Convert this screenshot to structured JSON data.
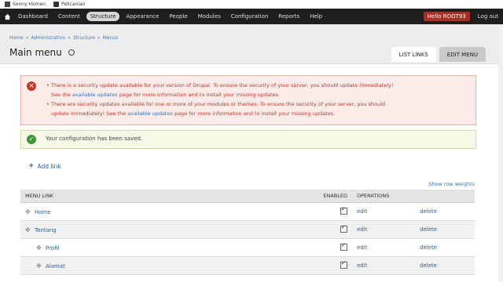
{
  "shortcuts": [
    {
      "label": "Sonny Homen"
    },
    {
      "label": "Pelicanian"
    }
  ],
  "toolbar": {
    "items": [
      "Dashboard",
      "Content",
      "Structure",
      "Appearance",
      "People",
      "Modules",
      "Configuration",
      "Reports",
      "Help"
    ],
    "active": "Structure",
    "hello": "Hello ROOT93",
    "logout": "Log out"
  },
  "breadcrumb": [
    "Home",
    "Administration",
    "Structure",
    "Menus"
  ],
  "page_title": "Main menu",
  "tabs": [
    "LIST LINKS",
    "EDIT MENU"
  ],
  "error": {
    "item1_a": "There is a security update available for your version of Drupal. To ensure the security of your server, you should update immediately!",
    "item1_b": "See the",
    "item1_link": "available updates",
    "item1_c": "page for more information and to install your missing updates.",
    "item2_a": "There are security updates available for one or more of your modules or themes. To ensure the security of your server, you should",
    "item2_b": "update immediately! See the",
    "item2_link": "available updates",
    "item2_c": "page for more information and to install your missing updates."
  },
  "status": "Your configuration has been saved.",
  "add_link": "Add link",
  "show_weights": "Show row weights",
  "table": {
    "headers": [
      "MENU LINK",
      "ENABLED",
      "OPERATIONS"
    ],
    "rows": [
      {
        "label": "Home",
        "edit": "edit",
        "delete": "delete"
      },
      {
        "label": "Tentang",
        "edit": "edit",
        "delete": "delete"
      },
      {
        "label": "Profil",
        "edit": "edit",
        "delete": "delete"
      },
      {
        "label": "Alamat",
        "edit": "edit",
        "delete": "delete"
      }
    ]
  },
  "colors": {
    "toolbar": "#1e1e1e",
    "error": "#b03a2e",
    "link": "#2f5f99",
    "hello_bg": "#b02a20"
  }
}
